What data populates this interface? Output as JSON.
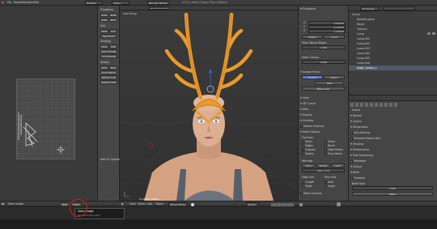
{
  "top_bar": {
    "menus": [
      "File",
      "Render",
      "Window",
      "Help"
    ],
    "layout": "Default",
    "scene": "Scene",
    "engine": "Blender Render",
    "stats": "v2.7x | Verts | Faces | Tris | Objects"
  },
  "toolbar": {
    "sections": [
      "Transform",
      "Edit",
      "History"
    ],
    "buttons": [
      "Translate",
      "Rotate",
      "Scale",
      "Mirror",
      "Duplicate",
      "Join",
      "Set Origin",
      "Shading",
      "Smooth",
      "Flat",
      "Data Transfer",
      "UV Unwrap",
      "Undo",
      "Redo",
      "Undo History",
      "Repeat Last",
      "Repeat History"
    ],
    "operator_panel": "Add UV Sphere"
  },
  "uv_editor": {
    "label": "UV/Image Editor"
  },
  "viewport": {
    "header_label": "User Persp",
    "object_label": "(1) Aldgh_Avatar_v",
    "manipulator_colors": {
      "x": "#d23b3b",
      "y": "#57b53f",
      "z": "#3b68d2"
    }
  },
  "properties_n": {
    "transform_title": "Transform",
    "fields": [
      {
        "label": "X",
        "value": "0.00000"
      },
      {
        "label": "Y",
        "value": "-0.11043"
      },
      {
        "label": "Z",
        "value": "1.32640"
      }
    ],
    "global_local": [
      "Global",
      "Local"
    ],
    "mean_weight_label": "Mean Bevel Weight",
    "mean_weight": "0.000",
    "crease_label": "Mean Crease",
    "crease": "0.000",
    "grease_pencil": "Grease Pencil",
    "gp_buttons": [
      "Scene",
      "Object"
    ],
    "new_label": "New",
    "new_layer": "New Layer",
    "panels": [
      "View",
      "3D Cursor",
      "Item",
      "Display",
      "Shading",
      "Motion Tracking",
      "Mesh Display"
    ],
    "overlays_title": "Overlays",
    "overlay_items": [
      "Faces",
      "Edges",
      "Creases",
      "Seams",
      "Sharp",
      "Bevel",
      "Edge Marks",
      "Face Marks"
    ],
    "normals_label": "Normals",
    "normal_items": [
      "Face",
      "Vertex",
      "Split"
    ],
    "size_label": "Size: 0.10",
    "mesh_analysis": "Mesh Analysis",
    "edge_info": "Edge Info",
    "face_info": "Face Info",
    "edge_items": [
      "Length",
      "Angle"
    ],
    "face_items": [
      "Area",
      "Angle"
    ]
  },
  "outliner": {
    "header": "All Scenes",
    "items": [
      "Scene",
      "RenderLayers",
      "World",
      "Camera",
      "Lamp",
      "Lamp.001",
      "Lamp.002",
      "Lamp.003",
      "Lamp.004",
      "Lamp.005",
      "Lamp.006",
      "Aldgh_Avatar_v"
    ]
  },
  "properties": {
    "context": "Scene",
    "panels": [
      "Render",
      "Layers",
      "Dimensions",
      "Anti-Aliasing",
      "Sampled Motion Blur",
      "Shading",
      "Performance",
      "Post Processing",
      "Metadata",
      "Output",
      "Bake",
      "Freestyle"
    ],
    "bake_label": "Bake",
    "bake_value": "0.000",
    "bake_mode": "Bake Type",
    "bake_button": "Bake"
  },
  "bottom_bar": {
    "menus": [
      "View",
      "Select",
      "Add",
      "Object"
    ],
    "mode": "Object Mode",
    "shading": "Global",
    "uv_menus": [
      "View",
      "Image"
    ],
    "new_button": "New",
    "open_button": "Open",
    "tooltip_title": "Open Image",
    "tooltip_python": "bpy.ops.image.open()"
  },
  "highlight_color": "#e11b1b",
  "accent": "#5680c2"
}
